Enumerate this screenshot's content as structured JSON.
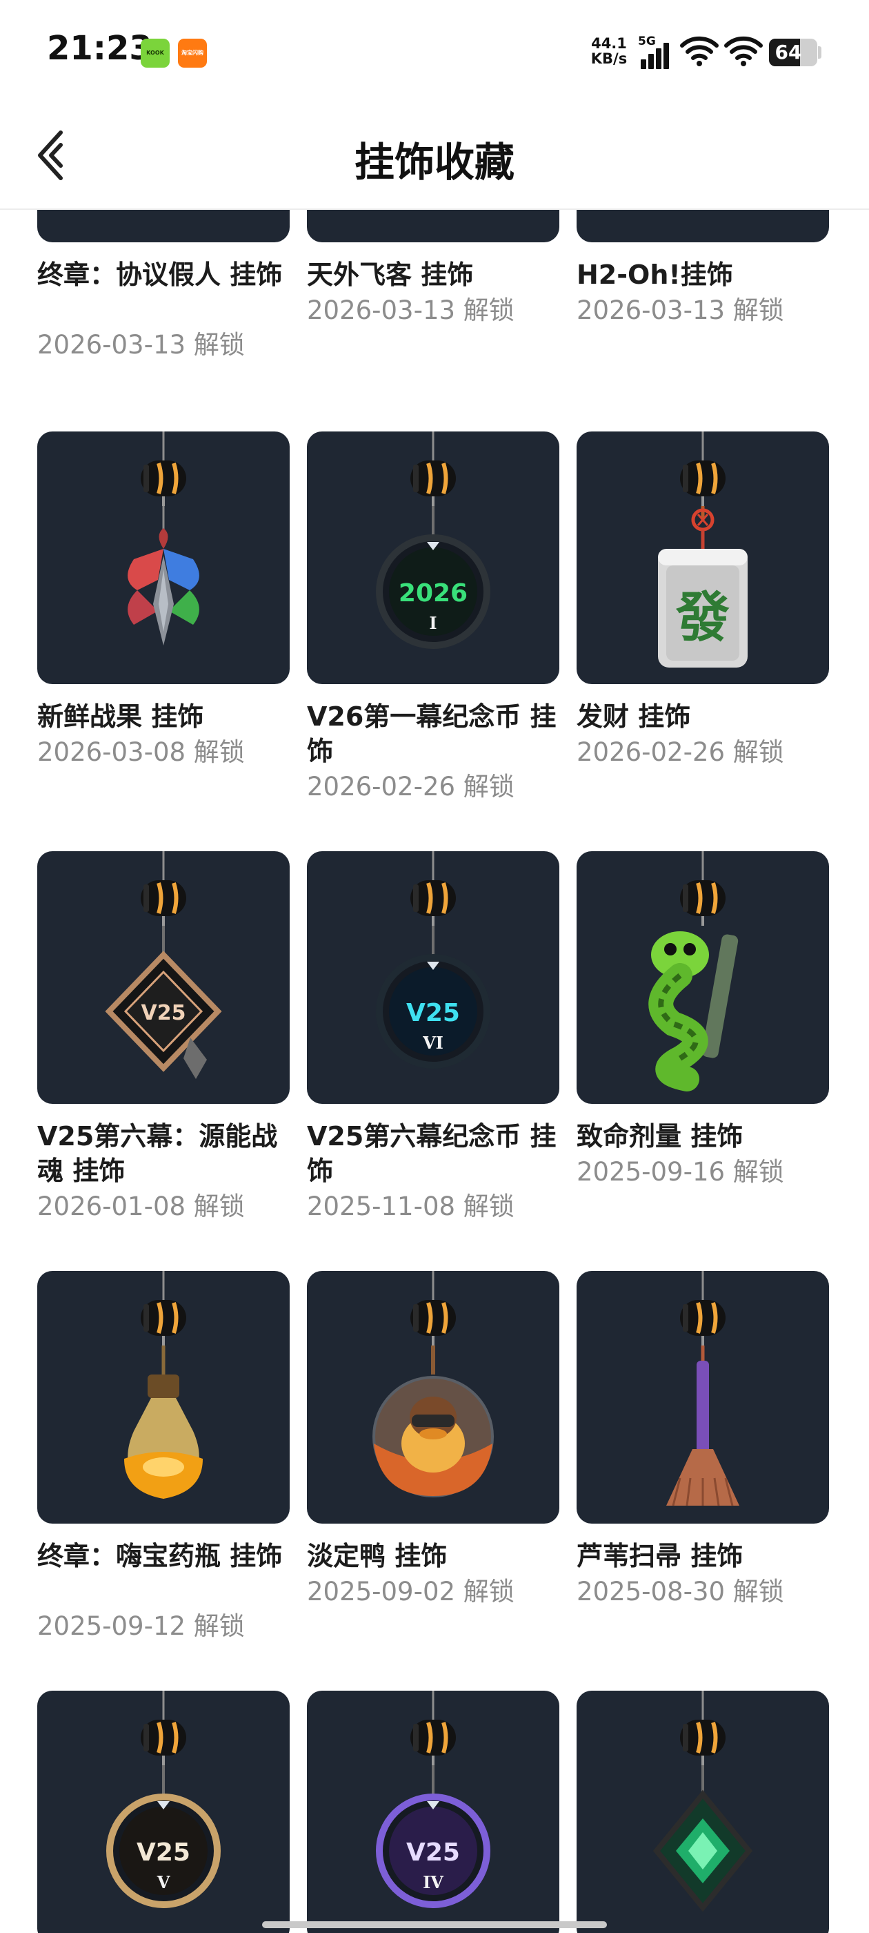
{
  "status_bar": {
    "time": "21:23",
    "apps": [
      {
        "icon": "kook-app-icon",
        "text": "KOOK"
      },
      {
        "icon": "taobao-flash-app-icon",
        "text": "淘宝闪购"
      }
    ],
    "net_speed_value": "44.1",
    "net_speed_unit": "KB/s",
    "network": "5G",
    "battery": "64",
    "battery_level": 0.64
  },
  "nav": {
    "title": "挂饰收藏",
    "back_icon": "back-arrow-icon"
  },
  "items": [
    {
      "name": "终章：协议假人 挂饰",
      "date": "2026-03-13 解锁",
      "art": "dummy"
    },
    {
      "name": "天外飞客 挂饰",
      "date": "2026-03-13 解锁",
      "art": "ufo"
    },
    {
      "name": "H2-Oh!挂饰",
      "date": "2026-03-13 解锁",
      "art": "bottle-blue"
    },
    {
      "name": "新鲜战果 挂饰",
      "date": "2026-03-08 解锁",
      "art": "leaf"
    },
    {
      "name": "V26第一幕纪念币 挂饰",
      "date": "2026-02-26 解锁",
      "art": "coin-2026",
      "coin_text": "2026",
      "coin_sub": "I"
    },
    {
      "name": "发财 挂饰",
      "date": "2026-02-26 解锁",
      "art": "mahjong",
      "tile_text": "發"
    },
    {
      "name": "V25第六幕：源能战魂 挂饰",
      "date": "2026-01-08 解锁",
      "art": "diamond-v25",
      "coin_text": "V25"
    },
    {
      "name": "V25第六幕纪念币 挂饰",
      "date": "2025-11-08 解锁",
      "art": "coin-v25",
      "coin_text": "V25",
      "coin_sub": "VI"
    },
    {
      "name": "致命剂量 挂饰",
      "date": "2025-09-16 解锁",
      "art": "snake"
    },
    {
      "name": "终章：嗨宝药瓶 挂饰",
      "date": "2025-09-12 解锁",
      "art": "potion"
    },
    {
      "name": "淡定鸭 挂饰",
      "date": "2025-09-02 解锁",
      "art": "duck"
    },
    {
      "name": "芦苇扫帚 挂饰",
      "date": "2025-08-30 解锁",
      "art": "broom"
    },
    {
      "name": "",
      "date": "",
      "art": "coin-v25-gold",
      "coin_text": "V25",
      "coin_sub": "V"
    },
    {
      "name": "",
      "date": "",
      "art": "coin-v25-purple",
      "coin_text": "V25",
      "coin_sub": "IV"
    },
    {
      "name": "",
      "date": "",
      "art": "diamond-green"
    }
  ],
  "colors": {
    "card_bg": "#1f2733",
    "title_text": "#1c1c1c",
    "date_text": "#8c8c8c",
    "clip_orange": "#f0a53a"
  }
}
